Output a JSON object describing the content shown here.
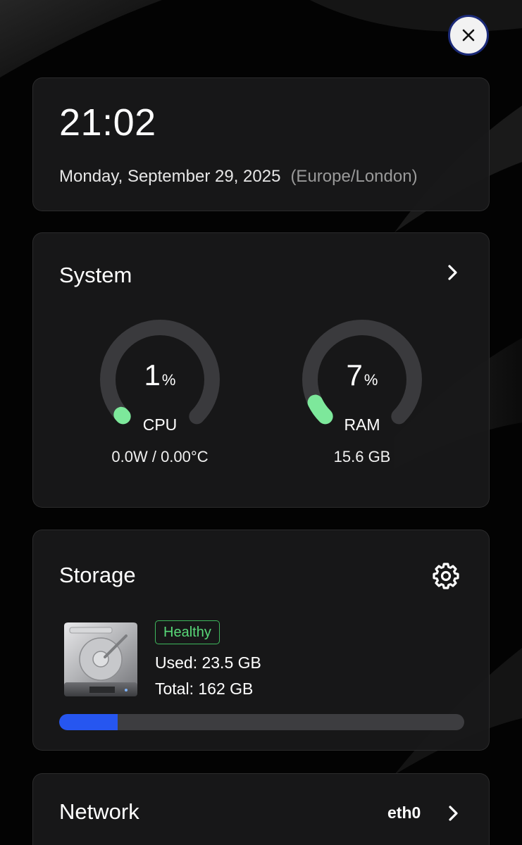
{
  "close_button": {
    "icon": "close-icon"
  },
  "clock": {
    "time": "21:02",
    "date": "Monday, September 29, 2025",
    "timezone": "(Europe/London)"
  },
  "system": {
    "title": "System",
    "cpu": {
      "value": "1",
      "unit": "%",
      "label": "CPU",
      "detail": "0.0W / 0.00°C",
      "percent": 1
    },
    "ram": {
      "value": "7",
      "unit": "%",
      "label": "RAM",
      "detail": "15.6 GB",
      "percent": 7
    },
    "gauge_color": "#7de89b",
    "track_color": "#3a3a3d"
  },
  "storage": {
    "title": "Storage",
    "status": "Healthy",
    "used": "Used: 23.5 GB",
    "total": "Total: 162 GB",
    "used_fraction": 0.145,
    "bar_color": "#2656f0",
    "status_color": "#58d878"
  },
  "network": {
    "title": "Network",
    "interface": "eth0"
  }
}
